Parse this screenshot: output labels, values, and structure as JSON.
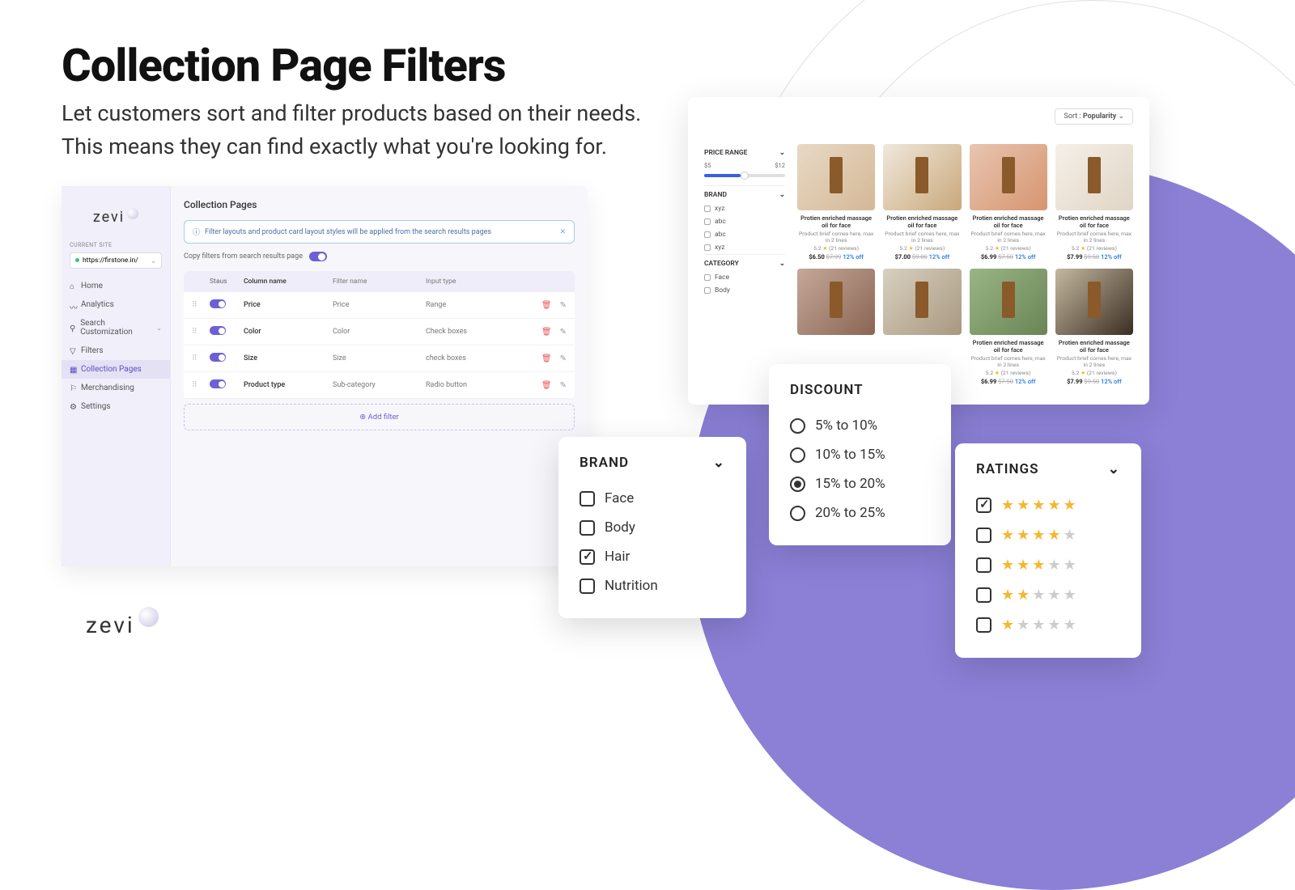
{
  "hero": {
    "title": "Collection Page Filters",
    "sub1": "Let customers sort and filter products based on their needs.",
    "sub2": "This means they can find exactly what you're looking for."
  },
  "brand": "zevi",
  "admin": {
    "current_site_label": "CURRENT SITE",
    "site_url": "https://firstone.in/",
    "nav": [
      {
        "label": "Home"
      },
      {
        "label": "Analytics"
      },
      {
        "label": "Search Customization"
      },
      {
        "label": "Filters"
      },
      {
        "label": "Collection Pages"
      },
      {
        "label": "Merchandising"
      },
      {
        "label": "Settings"
      }
    ],
    "page_title": "Collection Pages",
    "info_banner": "Filter layouts and product card layout styles will be applied from the search results pages",
    "copy_filters_label": "Copy filters from search results page",
    "table_headers": {
      "status": "Staus",
      "col": "Column name",
      "filter": "Filter name",
      "input": "Input type"
    },
    "rows": [
      {
        "col": "Price",
        "filter": "Price",
        "input": "Range"
      },
      {
        "col": "Color",
        "filter": "Color",
        "input": "Check boxes"
      },
      {
        "col": "Size",
        "filter": "Size",
        "input": "check boxes"
      },
      {
        "col": "Product type",
        "filter": "Sub-category",
        "input": "Radio button"
      }
    ],
    "add_filter_label": "Add filter"
  },
  "store": {
    "sort_label": "Sort :",
    "sort_value": "Popularity",
    "facets": {
      "price_range": "PRICE RANGE",
      "price_min": "$5",
      "price_max": "$12",
      "brand": "BRAND",
      "brand_opts": [
        "xyz",
        "abc",
        "abc",
        "xyz"
      ],
      "category": "CATEGORY",
      "cat_opts": [
        "Face",
        "Body"
      ]
    },
    "product": {
      "title": "Protien enriched massage oil for face",
      "desc": "Product brief comes here, max in 2 lines",
      "rating": "5.2",
      "reviews": "(21 reviews)",
      "off_label": "12% off"
    },
    "prices": [
      {
        "now": "$6.50",
        "was": "$7.99"
      },
      {
        "now": "$7.00",
        "was": "$9.00"
      },
      {
        "now": "$6.99",
        "was": "$7.50"
      },
      {
        "now": "$7.99",
        "was": "$9.50"
      }
    ]
  },
  "popups": {
    "brand_title": "BRAND",
    "brand_opts": [
      {
        "label": "Face",
        "checked": false
      },
      {
        "label": "Body",
        "checked": false
      },
      {
        "label": "Hair",
        "checked": true
      },
      {
        "label": "Nutrition",
        "checked": false
      }
    ],
    "discount_title": "DISCOUNT",
    "discount_opts": [
      {
        "label": "5% to 10%",
        "checked": false
      },
      {
        "label": "10% to 15%",
        "checked": false
      },
      {
        "label": "15% to 20%",
        "checked": true
      },
      {
        "label": "20% to 25%",
        "checked": false
      }
    ],
    "ratings_title": "RATINGS",
    "ratings_opts": [
      {
        "stars": 5,
        "checked": true
      },
      {
        "stars": 4,
        "checked": false
      },
      {
        "stars": 3,
        "checked": false
      },
      {
        "stars": 2,
        "checked": false
      },
      {
        "stars": 1,
        "checked": false
      }
    ]
  }
}
